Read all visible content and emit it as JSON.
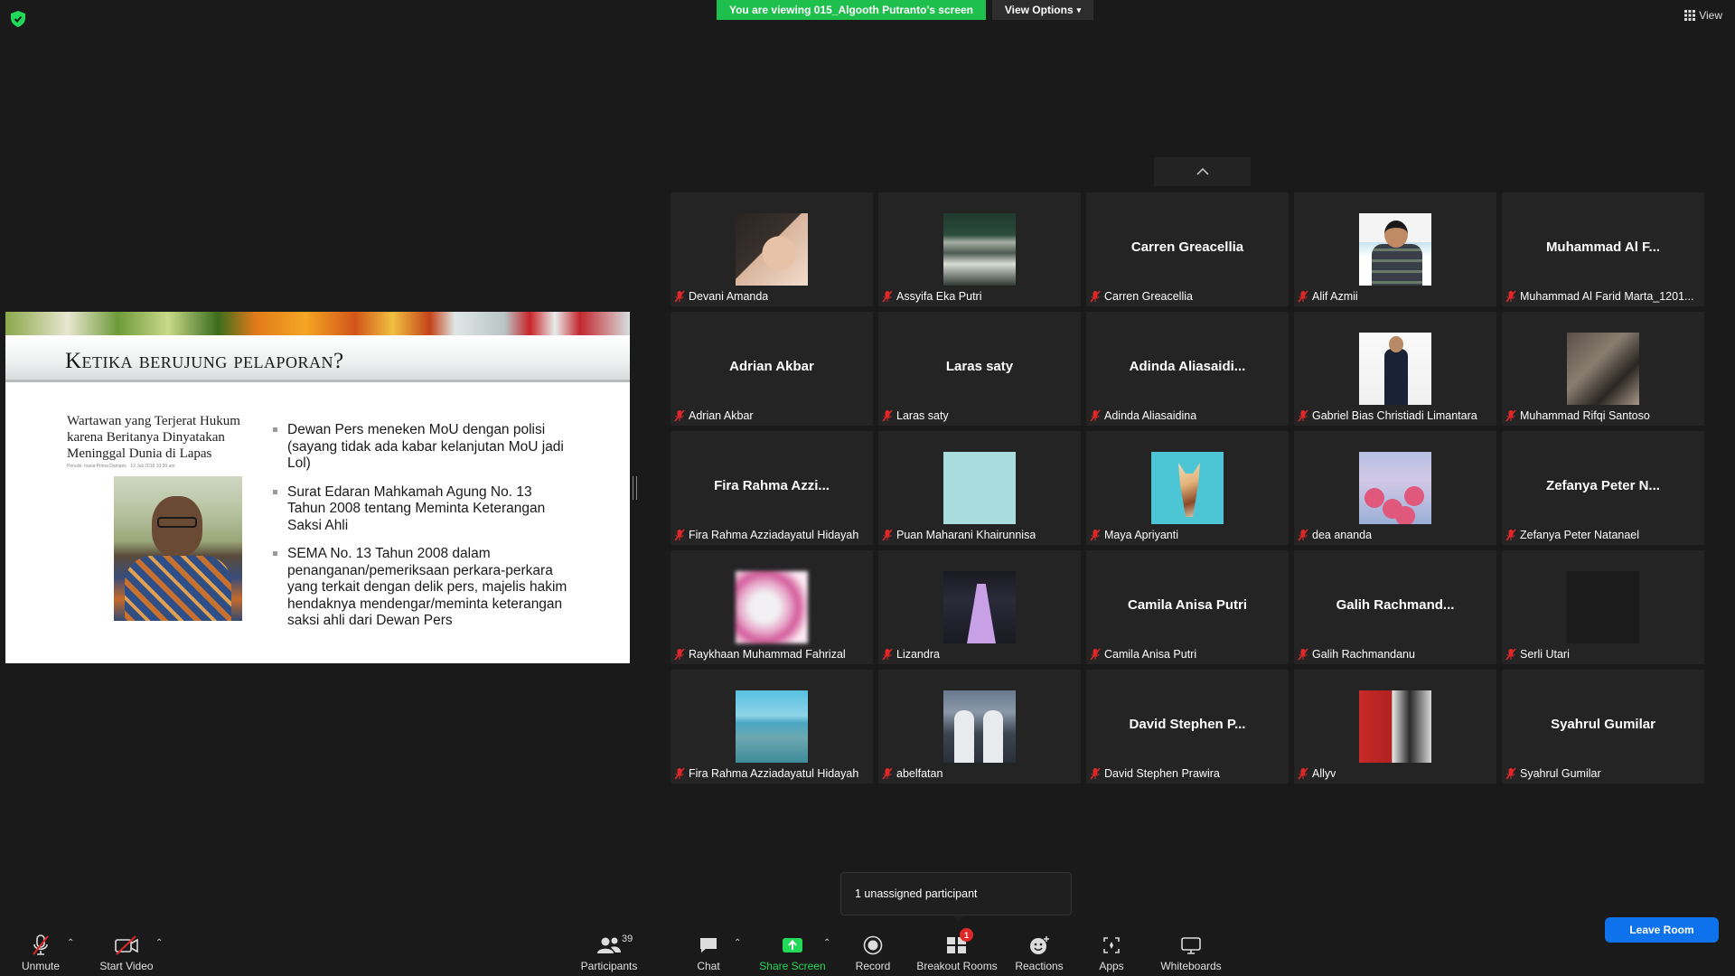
{
  "top": {
    "banner": "You are viewing 015_Algooth Putranto's screen",
    "view_options": "View Options",
    "view": "View"
  },
  "slide": {
    "title": "Ketika berujung pelaporan?",
    "article_title": "Wartawan yang Terjerat Hukum karena Beritanya Dinyatakan Meninggal Dunia di Lapas",
    "article_meta": "Penulis: Ivana Prima Damaris · 12 Juli 2018 10:39 am",
    "bullets": [
      "Dewan Pers meneken MoU dengan polisi (sayang tidak ada kabar kelanjutan MoU jadi Lol)",
      "Surat Edaran Mahkamah Agung No. 13 Tahun 2008 tentang Meminta Keterangan Saksi Ahli",
      "SEMA No. 13 Tahun 2008 dalam penanganan/pemeriksaan perkara-perkara yang terkait dengan delik pers, majelis hakim hendaknya mendengar/meminta keterangan saksi ahli dari Dewan Pers"
    ]
  },
  "participants": [
    {
      "label": "Devani Amanda"
    },
    {
      "label": "Assyifa Eka Putri"
    },
    {
      "label": "Carren Greacellia",
      "display": "Carren Greacellia"
    },
    {
      "label": "Alif Azmii"
    },
    {
      "label": "Muhammad Al Farid Marta_1201...",
      "display": "Muhammad Al F..."
    },
    {
      "label": "Adrian Akbar",
      "display": "Adrian Akbar"
    },
    {
      "label": "Laras saty",
      "display": "Laras saty"
    },
    {
      "label": "Adinda Aliasaidina",
      "display": "Adinda  Aliasaidi..."
    },
    {
      "label": "Gabriel Bias Christiadi Limantara"
    },
    {
      "label": "Muhammad Rifqi Santoso"
    },
    {
      "label": "Fira Rahma Azziadayatul Hidayah",
      "display": "Fira Rahma Azzi..."
    },
    {
      "label": "Puan Maharani Khairunnisa"
    },
    {
      "label": "Maya Apriyanti"
    },
    {
      "label": "dea ananda"
    },
    {
      "label": "Zefanya Peter Natanael",
      "display": "Zefanya Peter N..."
    },
    {
      "label": "Raykhaan Muhammad Fahrizal"
    },
    {
      "label": "Lizandra"
    },
    {
      "label": "Camila Anisa Putri",
      "display": "Camila Anisa Putri"
    },
    {
      "label": "Galih Rachmandanu",
      "display": "Galih  Rachmand..."
    },
    {
      "label": "Serli Utari"
    },
    {
      "label": "Fira Rahma Azziadayatul Hidayah"
    },
    {
      "label": "abelfatan"
    },
    {
      "label": "David Stephen Prawira",
      "display": "David Stephen  P..."
    },
    {
      "label": "Allyv"
    },
    {
      "label": "Syahrul Gumilar",
      "display": "Syahrul Gumilar"
    }
  ],
  "popup": "1 unassigned participant",
  "toolbar": {
    "unmute": "Unmute",
    "start_video": "Start Video",
    "participants": "Participants",
    "participants_count": "39",
    "chat": "Chat",
    "share_screen": "Share Screen",
    "record": "Record",
    "breakout_rooms": "Breakout Rooms",
    "breakout_badge": "1",
    "reactions": "Reactions",
    "apps": "Apps",
    "whiteboards": "Whiteboards",
    "leave": "Leave Room"
  },
  "colors": {
    "banner": "#1fbf4e",
    "share_icon": "#23d959",
    "leave": "#0e72ed",
    "mute": "#e02828"
  }
}
